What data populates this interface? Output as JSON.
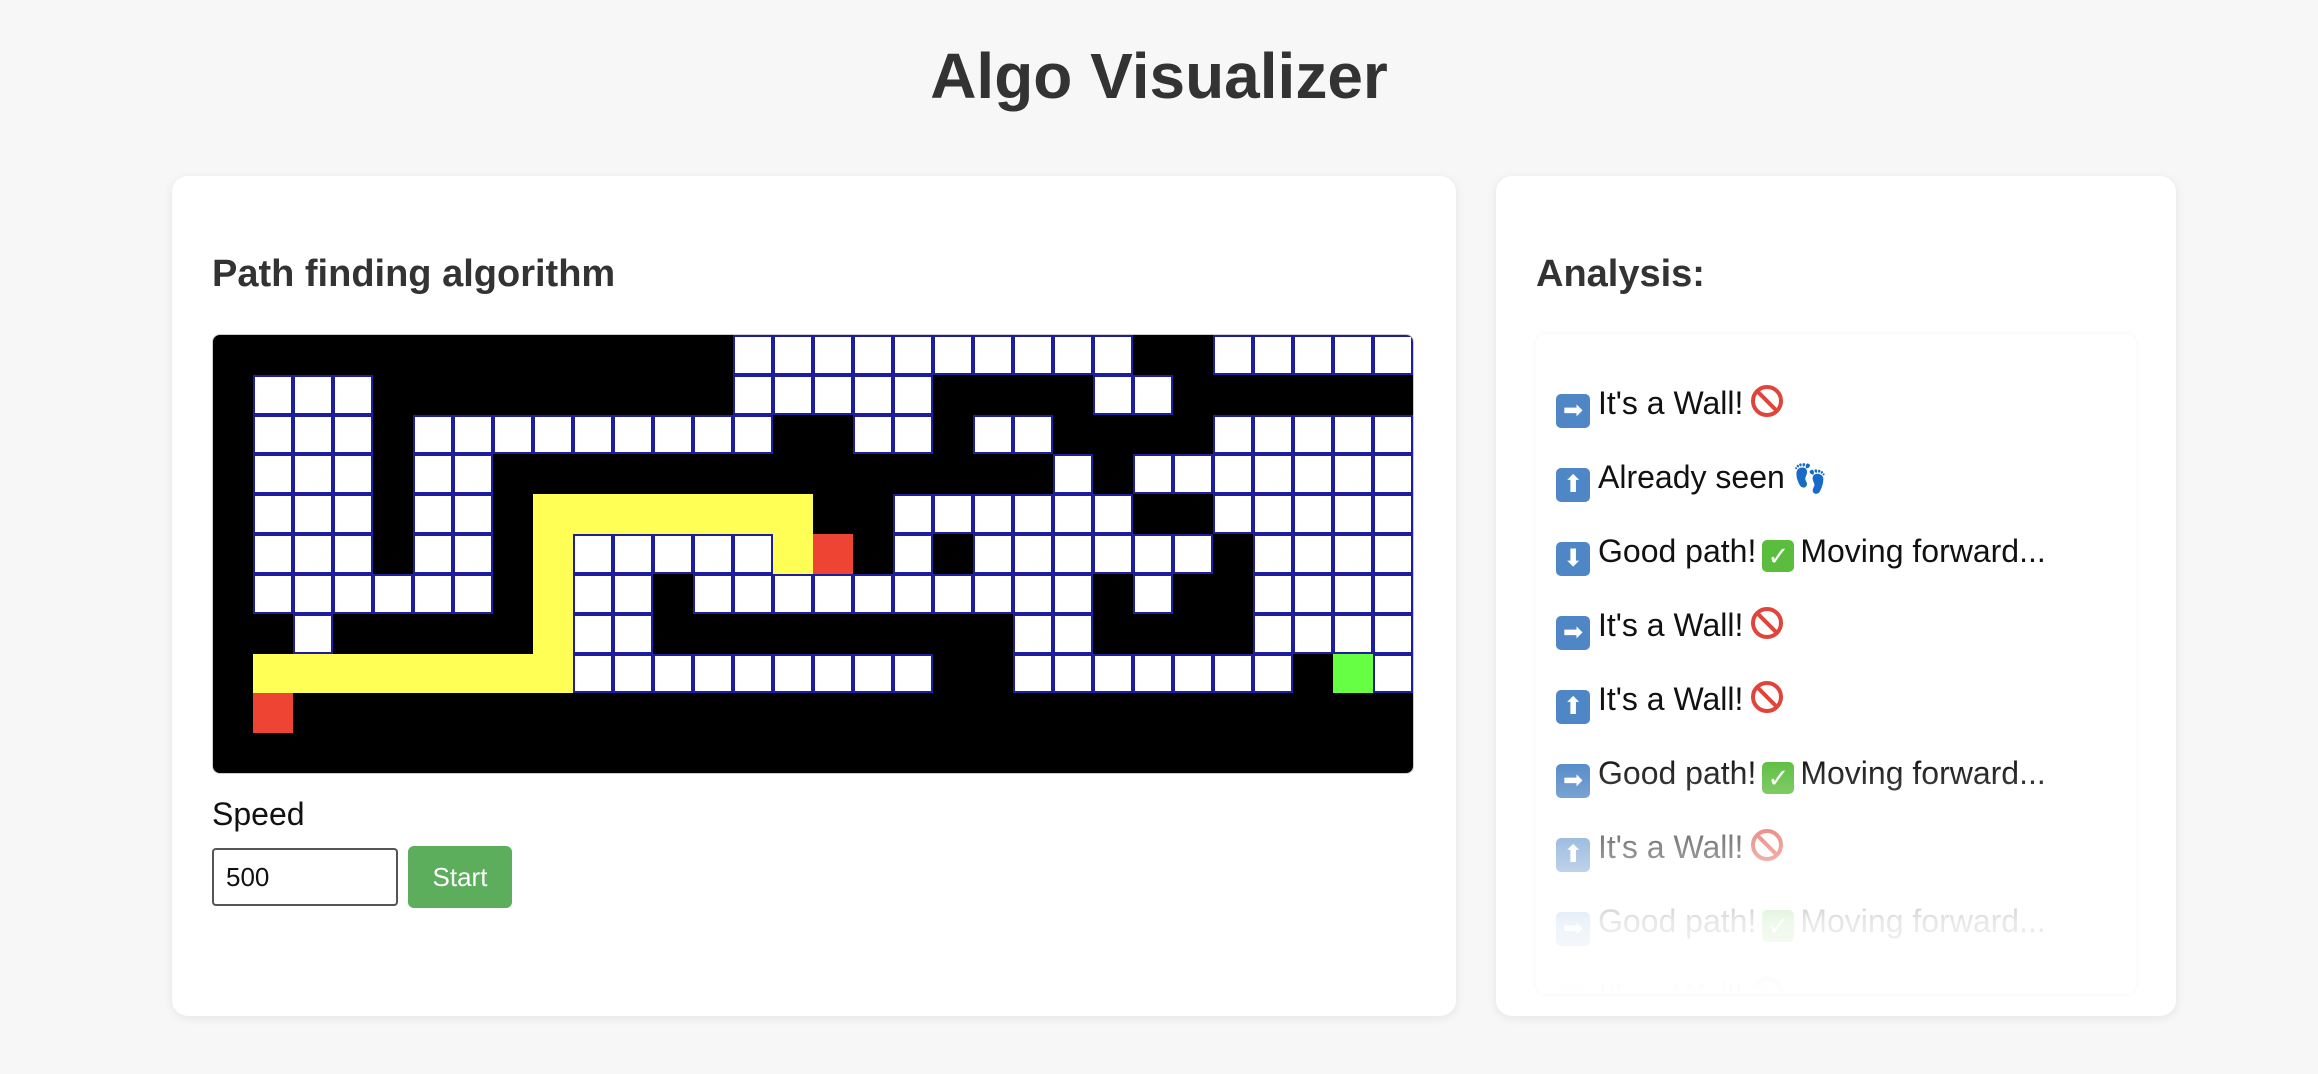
{
  "app": {
    "title": "Algo Visualizer"
  },
  "main": {
    "title": "Path finding algorithm",
    "speed_label": "Speed",
    "speed_value": "500",
    "start_label": "Start"
  },
  "grid": {
    "cols": 30,
    "rows": 11,
    "colors": {
      "open": "#ffffff",
      "wall": "#000000",
      "path": "#ffff55",
      "marker": "#ee4433",
      "goal": "#66ff44",
      "border": "#1d1d9e"
    },
    "cells": [
      "#############..........##.....",
      "#...#########.....####..######",
      "#...#.........##..#..####.....",
      "#...#..##############.#.......",
      "#...#..#PPPPPPP##......##.....",
      "#...#..#P.....PX#.#......#....",
      "#......#P..#..........#.##....",
      "##.#####P..#########..####....",
      "#PPPPPPPP.........##.......#G.",
      "#X############################",
      "##############################"
    ],
    "legend_note": ". open, # wall, P path, X marker, G goal"
  },
  "analysis": {
    "title": "Analysis:",
    "entries": [
      {
        "arrow": "➡",
        "text": "It's a Wall!",
        "mark": "ban"
      },
      {
        "arrow": "⬆",
        "text": "Already seen",
        "mark": "feet"
      },
      {
        "arrow": "⬇",
        "text": "Good path!",
        "mark": "check",
        "suffix": "Moving forward..."
      },
      {
        "arrow": "➡",
        "text": "It's a Wall!",
        "mark": "ban"
      },
      {
        "arrow": "⬆",
        "text": "It's a Wall!",
        "mark": "ban"
      },
      {
        "arrow": "➡",
        "text": "Good path!",
        "mark": "check",
        "suffix": "Moving forward..."
      },
      {
        "arrow": "⬆",
        "text": "It's a Wall!",
        "mark": "ban"
      },
      {
        "arrow": "➡",
        "text": "Good path!",
        "mark": "check",
        "suffix": "Moving forward..."
      },
      {
        "arrow": "⬆",
        "text": "It's a Wall!",
        "mark": "ban"
      }
    ]
  }
}
